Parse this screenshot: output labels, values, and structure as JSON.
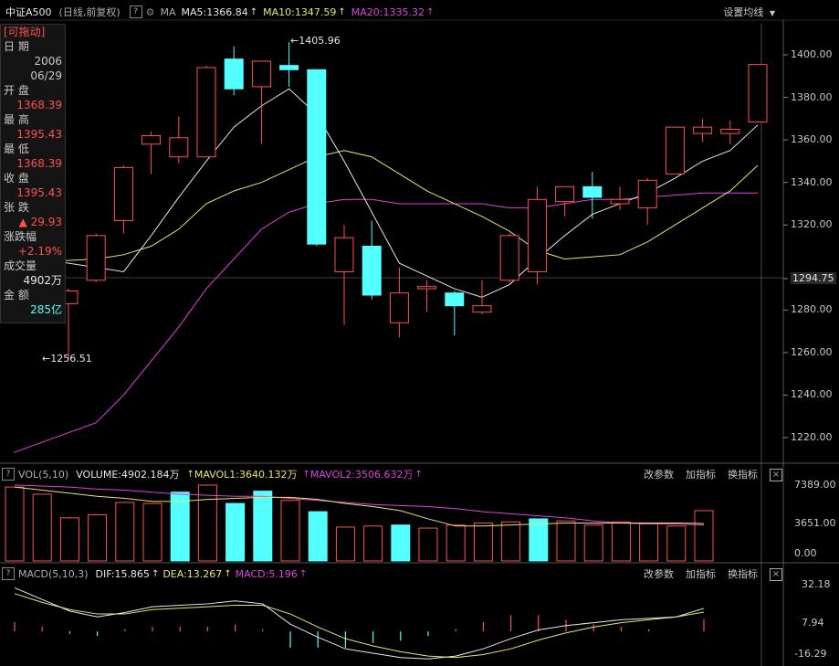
{
  "top_bar": {
    "symbol": "中证A500",
    "mode": "(日线,前复权)",
    "help_label": "?",
    "ma_label": "MA",
    "ma5": "MA5:1366.84",
    "ma10": "MA10:1347.59",
    "ma20": "MA20:1335.32",
    "settings_label": "设置均线"
  },
  "colors": {
    "up": "#ff5050",
    "down": "#54ffff",
    "ma5": "#e8e8e8",
    "ma10": "#e7e76a",
    "ma20": "#e040e0",
    "bg": "#000000"
  },
  "info_panel": {
    "draggable": "[可拖动]",
    "date_label": "日  期",
    "date_year": "2006",
    "date_md": "06/29",
    "open_label": "开  盘",
    "open": "1368.39",
    "high_label": "最  高",
    "high": "1395.43",
    "low_label": "最  低",
    "low": "1368.39",
    "close_label": "收  盘",
    "close": "1395.43",
    "change_label": "张  跌",
    "change": "▲ 29.93",
    "pct_label": "涨跌幅",
    "pct": "+2.19%",
    "volume_label": "成交量",
    "volume": "4902万",
    "amount_label": "金  额",
    "amount": "285亿"
  },
  "price_axis": [
    "1400.00",
    "1380.00",
    "1360.00",
    "1340.00",
    "1320.00",
    "1294.75",
    "1280.00",
    "1260.00",
    "1240.00",
    "1220.00"
  ],
  "annotations": {
    "high": "1405.96",
    "low": "1256.51"
  },
  "vol_bar": {
    "title": "VOL(5,10)",
    "volume": "VOLUME:4902.184万",
    "mavol1": "MAVOL1:3640.132万",
    "mavol2": "MAVOL2:3506.632万",
    "params": "改参数",
    "add": "加指标",
    "switch": "换指标",
    "axis": [
      "7389.00",
      "3651.00",
      "0.00"
    ]
  },
  "macd_bar": {
    "title": "MACD(5,10,3)",
    "dif": "DIF:15.865",
    "dea": "DEA:13.267",
    "macd": "MACD:5.196",
    "params": "改参数",
    "add": "加指标",
    "switch": "换指标",
    "axis": [
      "32.18",
      "7.94",
      "-16.29"
    ]
  },
  "chart_data": {
    "type": "candlestick",
    "candles": [
      {
        "o": 1283,
        "h": 1290,
        "l": 1256.51,
        "c": 1289
      },
      {
        "o": 1294,
        "h": 1316,
        "l": 1293,
        "c": 1315
      },
      {
        "o": 1322,
        "h": 1348,
        "l": 1316,
        "c": 1347
      },
      {
        "o": 1358,
        "h": 1364,
        "l": 1344,
        "c": 1362
      },
      {
        "o": 1352,
        "h": 1371,
        "l": 1349,
        "c": 1361
      },
      {
        "o": 1352,
        "h": 1395,
        "l": 1352,
        "c": 1394
      },
      {
        "o": 1398,
        "h": 1404,
        "l": 1381,
        "c": 1384
      },
      {
        "o": 1385,
        "h": 1397,
        "l": 1358,
        "c": 1397
      },
      {
        "o": 1395,
        "h": 1405.96,
        "l": 1385,
        "c": 1393
      },
      {
        "o": 1393,
        "h": 1393,
        "l": 1310,
        "c": 1311
      },
      {
        "o": 1298,
        "h": 1320,
        "l": 1273,
        "c": 1314
      },
      {
        "o": 1310,
        "h": 1322,
        "l": 1285,
        "c": 1287
      },
      {
        "o": 1274,
        "h": 1300,
        "l": 1267,
        "c": 1288
      },
      {
        "o": 1290,
        "h": 1294,
        "l": 1279,
        "c": 1291
      },
      {
        "o": 1288,
        "h": 1289,
        "l": 1268,
        "c": 1282
      },
      {
        "o": 1279,
        "h": 1294,
        "l": 1278,
        "c": 1282
      },
      {
        "o": 1294,
        "h": 1316,
        "l": 1293,
        "c": 1315
      },
      {
        "o": 1298,
        "h": 1338,
        "l": 1292,
        "c": 1332
      },
      {
        "o": 1331,
        "h": 1338,
        "l": 1324,
        "c": 1338
      },
      {
        "o": 1338,
        "h": 1345,
        "l": 1323,
        "c": 1333
      },
      {
        "o": 1330,
        "h": 1338,
        "l": 1327,
        "c": 1332
      },
      {
        "o": 1328,
        "h": 1342,
        "l": 1320,
        "c": 1341
      },
      {
        "o": 1344,
        "h": 1366,
        "l": 1344,
        "c": 1366
      },
      {
        "o": 1363,
        "h": 1370,
        "l": 1359,
        "c": 1366
      },
      {
        "o": 1363,
        "h": 1369,
        "l": 1358,
        "c": 1365
      },
      {
        "o": 1368.39,
        "h": 1395.43,
        "l": 1368.39,
        "c": 1395.43
      }
    ],
    "ma5": [
      1306,
      1300,
      1298,
      1315,
      1333,
      1350,
      1366,
      1376,
      1384,
      1372,
      1350,
      1326,
      1302,
      1296,
      1290,
      1286,
      1292,
      1304,
      1315,
      1325,
      1330,
      1335,
      1342,
      1350,
      1355,
      1367
    ],
    "ma10": [
      1302,
      1304,
      1306,
      1310,
      1318,
      1330,
      1336,
      1340,
      1346,
      1352,
      1355,
      1352,
      1344,
      1336,
      1330,
      1324,
      1317,
      1308,
      1304,
      1305,
      1306,
      1312,
      1320,
      1328,
      1336,
      1348
    ],
    "ma20": [
      1213,
      1227,
      1240,
      1256,
      1272,
      1290,
      1304,
      1318,
      1326,
      1330,
      1332,
      1332,
      1330,
      1330,
      1330,
      1330,
      1328,
      1328,
      1330,
      1332,
      1332,
      1333,
      1334,
      1335,
      1335,
      1335
    ],
    "volume": [
      7200,
      6500,
      4200,
      4500,
      5700,
      5600,
      6700,
      7389,
      5600,
      6800,
      5900,
      4800,
      3300,
      3400,
      3500,
      3200,
      3500,
      3700,
      3800,
      4100,
      3900,
      3500,
      3800,
      3600,
      3400,
      4902
    ],
    "mavol1": [
      7200,
      6900,
      6600,
      6300,
      6100,
      5800,
      5800,
      6000,
      6100,
      6200,
      6200,
      6000,
      5600,
      5300,
      4900,
      4100,
      3400,
      3400,
      3500,
      3600,
      3700,
      3700,
      3700,
      3700,
      3700,
      3640
    ],
    "mavol2": [
      7400,
      7300,
      7200,
      7000,
      6900,
      6700,
      6500,
      6400,
      6300,
      6300,
      6100,
      5900,
      5700,
      5500,
      5400,
      5300,
      5100,
      4800,
      4600,
      4400,
      4200,
      3900,
      3700,
      3600,
      3600,
      3507
    ],
    "dif": [
      30,
      22,
      14,
      10,
      13,
      17,
      18,
      19,
      21,
      19,
      5,
      -4,
      -12,
      -15,
      -18,
      -19,
      -17,
      -12,
      -5,
      1,
      4,
      6,
      8,
      9,
      10,
      15.865
    ],
    "dea": [
      26,
      20,
      15,
      12,
      12,
      15,
      16,
      17,
      18,
      18,
      12,
      3,
      -5,
      -10,
      -14,
      -17,
      -18,
      -16,
      -12,
      -6,
      -1,
      3,
      6,
      8,
      10,
      13.267
    ],
    "macd": [
      4,
      2,
      -1,
      -2,
      1,
      2,
      2,
      2,
      3,
      1,
      -7,
      -7,
      -7,
      -5,
      -4,
      -2,
      1,
      4,
      7,
      7,
      5,
      3,
      2,
      1,
      0,
      5.196
    ]
  }
}
